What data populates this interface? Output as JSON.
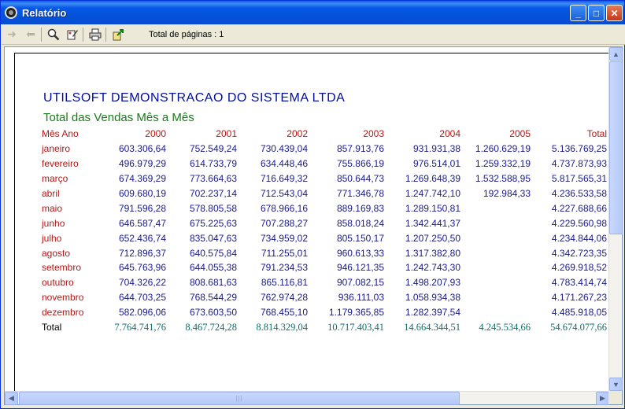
{
  "window": {
    "title": "Relatório",
    "minimize_label": "_",
    "maximize_label": "□",
    "close_label": "✕"
  },
  "toolbar": {
    "total_pages_label": "Total de páginas : 1",
    "tools": [
      {
        "name": "next-page-icon",
        "glyph": "➜"
      },
      {
        "name": "previous-page-icon",
        "glyph": "⬅"
      },
      {
        "name": "zoom-icon",
        "glyph": "🔍"
      },
      {
        "name": "setup-icon",
        "glyph": "✎"
      },
      {
        "name": "print-icon",
        "glyph": "🖶"
      },
      {
        "name": "export-icon",
        "glyph": "⇪"
      }
    ]
  },
  "report": {
    "company": "UTILSOFT DEMONSTRACAO DO SISTEMA LTDA",
    "subtitle": "Total das Vendas Mês a Mês",
    "header": {
      "month_year": "Mês   Ano",
      "columns": [
        "2000",
        "2001",
        "2002",
        "2003",
        "2004",
        "2005",
        "Total"
      ]
    },
    "rows": [
      {
        "month": "janeiro",
        "values": [
          "603.306,64",
          "752.549,24",
          "730.439,04",
          "857.913,76",
          "931.931,38",
          "1.260.629,19",
          "5.136.769,25"
        ]
      },
      {
        "month": "fevereiro",
        "values": [
          "496.979,29",
          "614.733,79",
          "634.448,46",
          "755.866,19",
          "976.514,01",
          "1.259.332,19",
          "4.737.873,93"
        ]
      },
      {
        "month": "março",
        "values": [
          "674.369,29",
          "773.664,63",
          "716.649,32",
          "850.644,73",
          "1.269.648,39",
          "1.532.588,95",
          "5.817.565,31"
        ]
      },
      {
        "month": "abril",
        "values": [
          "609.680,19",
          "702.237,14",
          "712.543,04",
          "771.346,78",
          "1.247.742,10",
          "192.984,33",
          "4.236.533,58"
        ]
      },
      {
        "month": "maio",
        "values": [
          "791.596,28",
          "578.805,58",
          "678.966,16",
          "889.169,83",
          "1.289.150,81",
          "",
          "4.227.688,66"
        ]
      },
      {
        "month": "junho",
        "values": [
          "646.587,47",
          "675.225,63",
          "707.288,27",
          "858.018,24",
          "1.342.441,37",
          "",
          "4.229.560,98"
        ]
      },
      {
        "month": "julho",
        "values": [
          "652.436,74",
          "835.047,63",
          "734.959,02",
          "805.150,17",
          "1.207.250,50",
          "",
          "4.234.844,06"
        ]
      },
      {
        "month": "agosto",
        "values": [
          "712.896,37",
          "640.575,84",
          "711.255,01",
          "960.613,33",
          "1.317.382,80",
          "",
          "4.342.723,35"
        ]
      },
      {
        "month": "setembro",
        "values": [
          "645.763,96",
          "644.055,38",
          "791.234,53",
          "946.121,35",
          "1.242.743,30",
          "",
          "4.269.918,52"
        ]
      },
      {
        "month": "outubro",
        "values": [
          "704.326,22",
          "808.681,63",
          "865.116,81",
          "907.082,15",
          "1.498.207,93",
          "",
          "4.783.414,74"
        ]
      },
      {
        "month": "novembro",
        "values": [
          "644.703,25",
          "768.544,29",
          "762.974,28",
          "936.111,03",
          "1.058.934,38",
          "",
          "4.171.267,23"
        ]
      },
      {
        "month": "dezembro",
        "values": [
          "582.096,06",
          "673.603,50",
          "768.455,10",
          "1.179.365,85",
          "1.282.397,54",
          "",
          "4.485.918,05"
        ]
      }
    ],
    "total_row": {
      "label": "Total",
      "values": [
        "7.764.741,76",
        "8.467.724,28",
        "8.814.329,04",
        "10.717.403,41",
        "14.664.344,51",
        "4.245.534,66",
        "54.674.077,66"
      ]
    }
  },
  "colors": {
    "titlebar": "#0758e5",
    "company_text": "#000c9c",
    "subtitle_text": "#1a7a1a",
    "month_text": "#b01818",
    "value_text": "#1a1a8c",
    "total_text": "#0c6f6a"
  }
}
